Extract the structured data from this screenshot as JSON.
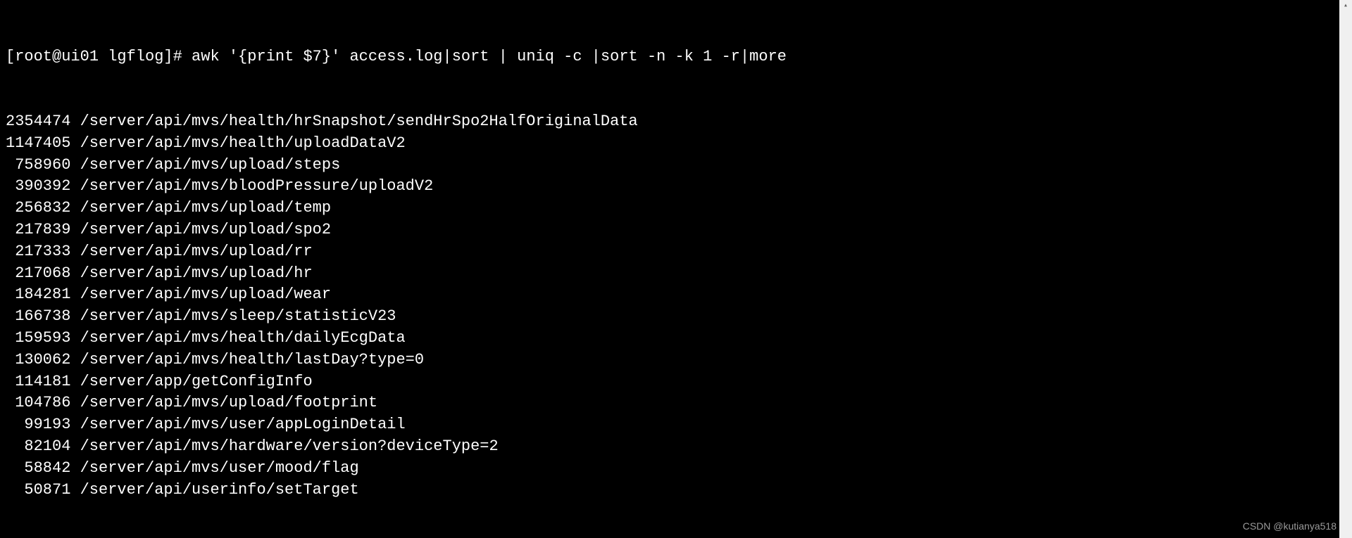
{
  "prompt": "[root@ui01 lgflog]# awk '{print $7}' access.log|sort | uniq -c |sort -n -k 1 -r|more",
  "rows": [
    {
      "count": "2354474",
      "path": "/server/api/mvs/health/hrSnapshot/sendHrSpo2HalfOriginalData"
    },
    {
      "count": "1147405",
      "path": "/server/api/mvs/health/uploadDataV2"
    },
    {
      "count": "758960",
      "path": "/server/api/mvs/upload/steps"
    },
    {
      "count": "390392",
      "path": "/server/api/mvs/bloodPressure/uploadV2"
    },
    {
      "count": "256832",
      "path": "/server/api/mvs/upload/temp"
    },
    {
      "count": "217839",
      "path": "/server/api/mvs/upload/spo2"
    },
    {
      "count": "217333",
      "path": "/server/api/mvs/upload/rr"
    },
    {
      "count": "217068",
      "path": "/server/api/mvs/upload/hr"
    },
    {
      "count": "184281",
      "path": "/server/api/mvs/upload/wear"
    },
    {
      "count": "166738",
      "path": "/server/api/mvs/sleep/statisticV23"
    },
    {
      "count": "159593",
      "path": "/server/api/mvs/health/dailyEcgData"
    },
    {
      "count": "130062",
      "path": "/server/api/mvs/health/lastDay?type=0"
    },
    {
      "count": "114181",
      "path": "/server/app/getConfigInfo"
    },
    {
      "count": "104786",
      "path": "/server/api/mvs/upload/footprint"
    },
    {
      "count": "99193",
      "path": "/server/api/mvs/user/appLoginDetail"
    },
    {
      "count": "82104",
      "path": "/server/api/mvs/hardware/version?deviceType=2"
    },
    {
      "count": "58842",
      "path": "/server/api/mvs/user/mood/flag"
    },
    {
      "count": "50871",
      "path": "/server/api/userinfo/setTarget"
    }
  ],
  "watermark": "CSDN @kutianya518"
}
